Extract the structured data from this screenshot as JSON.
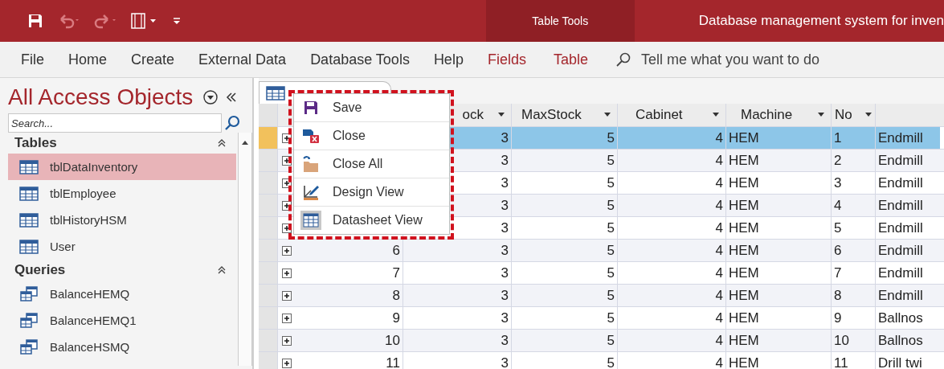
{
  "title_bar": {
    "context_tab": "Table Tools",
    "title": "Database management system for inven"
  },
  "ribbon_tabs": [
    {
      "label": "File",
      "contextual": false
    },
    {
      "label": "Home",
      "contextual": false
    },
    {
      "label": "Create",
      "contextual": false
    },
    {
      "label": "External Data",
      "contextual": false
    },
    {
      "label": "Database Tools",
      "contextual": false
    },
    {
      "label": "Help",
      "contextual": false
    },
    {
      "label": "Fields",
      "contextual": true
    },
    {
      "label": "Table",
      "contextual": true
    }
  ],
  "tell_me": {
    "placeholder": "Tell me what you want to do"
  },
  "navigation": {
    "title": "All Access Objects",
    "search": {
      "placeholder": "Search..."
    },
    "groups": [
      {
        "name": "Tables",
        "kind": "table",
        "items": [
          {
            "label": "tblDataInventory",
            "selected": true
          },
          {
            "label": "tblEmployee",
            "selected": false
          },
          {
            "label": "tblHistoryHSM",
            "selected": false
          },
          {
            "label": "User",
            "selected": false
          }
        ]
      },
      {
        "name": "Queries",
        "kind": "query",
        "items": [
          {
            "label": "BalanceHEMQ",
            "selected": false
          },
          {
            "label": "BalanceHEMQ1",
            "selected": false
          },
          {
            "label": "BalanceHSMQ",
            "selected": false
          }
        ]
      }
    ]
  },
  "datasheet": {
    "columns": [
      "ock",
      "MaxStock",
      "Cabinet",
      "Machine",
      "No"
    ],
    "rows": [
      {
        "selected": true,
        "values": [
          "3",
          "5",
          "4",
          "HEM",
          "1",
          "Endmill"
        ]
      },
      {
        "selected": false,
        "values": [
          "3",
          "5",
          "4",
          "HEM",
          "2",
          "Endmill"
        ]
      },
      {
        "selected": false,
        "values": [
          "3",
          "5",
          "4",
          "HEM",
          "3",
          "Endmill"
        ]
      },
      {
        "selected": false,
        "values": [
          "3",
          "5",
          "4",
          "HEM",
          "4",
          "Endmill"
        ]
      },
      {
        "selected": false,
        "values": [
          "3",
          "5",
          "4",
          "HEM",
          "5",
          "Endmill"
        ]
      },
      {
        "selected": false,
        "id": "6",
        "values": [
          "3",
          "5",
          "4",
          "HEM",
          "6",
          "Endmill"
        ]
      },
      {
        "selected": false,
        "id": "7",
        "values": [
          "3",
          "5",
          "4",
          "HEM",
          "7",
          "Endmill"
        ]
      },
      {
        "selected": false,
        "id": "8",
        "values": [
          "3",
          "5",
          "4",
          "HEM",
          "8",
          "Endmill"
        ]
      },
      {
        "selected": false,
        "id": "9",
        "values": [
          "3",
          "5",
          "4",
          "HEM",
          "9",
          "Ballnos"
        ]
      },
      {
        "selected": false,
        "id": "10",
        "values": [
          "3",
          "5",
          "4",
          "HEM",
          "10",
          "Ballnos"
        ]
      },
      {
        "selected": false,
        "id": "11",
        "values": [
          "3",
          "5",
          "4",
          "HEM",
          "11",
          "Drill twi"
        ]
      }
    ]
  },
  "context_menu": {
    "items": [
      {
        "kind": "save",
        "label": "Save"
      },
      {
        "kind": "close",
        "label": "Close"
      },
      {
        "kind": "close-all",
        "label": "Close All"
      },
      {
        "kind": "design",
        "label": "Design View"
      },
      {
        "kind": "datasheet",
        "label": "Datasheet View"
      }
    ]
  }
}
